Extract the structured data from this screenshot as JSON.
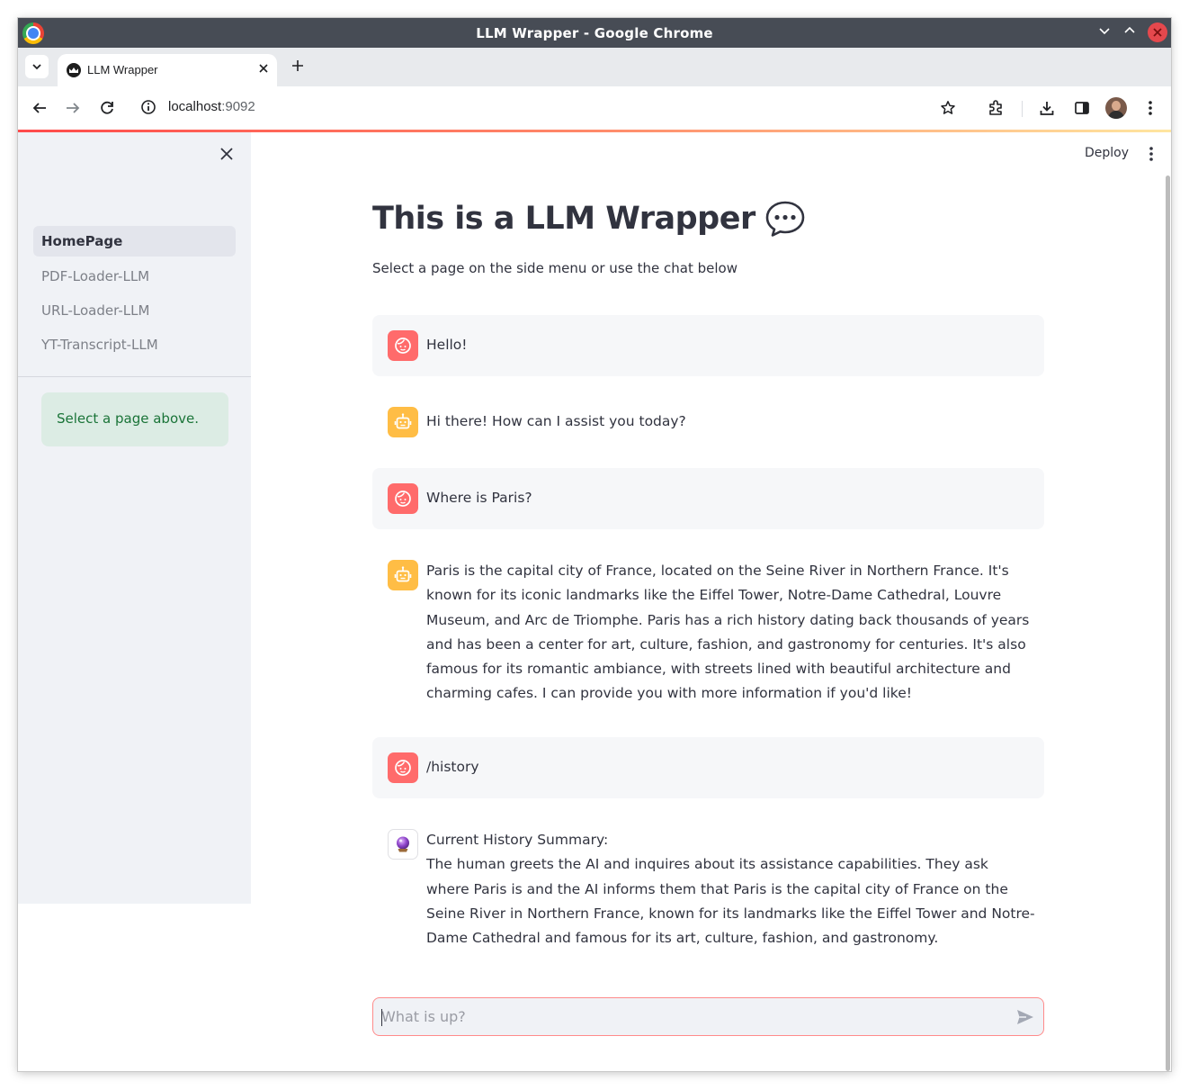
{
  "window": {
    "title": "LLM Wrapper - Google Chrome"
  },
  "tabs": [
    {
      "title": "LLM Wrapper",
      "active": true
    }
  ],
  "toolbar": {
    "url_host": "localhost",
    "url_port": ":9092"
  },
  "app": {
    "deploy_label": "Deploy",
    "title": "This is a LLM Wrapper",
    "title_emoji_icon": "speech-bubble-icon",
    "subtitle": "Select a page on the side menu or use the chat below"
  },
  "sidebar": {
    "items": [
      {
        "label": "HomePage",
        "active": true
      },
      {
        "label": "PDF-Loader-LLM",
        "active": false
      },
      {
        "label": "URL-Loader-LLM",
        "active": false
      },
      {
        "label": "YT-Transcript-LLM",
        "active": false
      }
    ],
    "info": "Select a page above."
  },
  "chat": {
    "messages": [
      {
        "role": "user",
        "avatar": "user-face-icon",
        "text": "Hello!"
      },
      {
        "role": "assistant",
        "avatar": "robot-icon",
        "text": "Hi there! How can I assist you today?"
      },
      {
        "role": "user",
        "avatar": "user-face-icon",
        "text": "Where is Paris?"
      },
      {
        "role": "assistant",
        "avatar": "robot-icon",
        "text": "Paris is the capital city of France, located on the Seine River in Northern France. It's known for its iconic landmarks like the Eiffel Tower, Notre-Dame Cathedral, Louvre Museum, and Arc de Triomphe. Paris has a rich history dating back thousands of years and has been a center for art, culture, fashion, and gastronomy for centuries. It's also famous for its romantic ambiance, with streets lined with beautiful architecture and charming cafes. I can provide you with more information if you'd like!"
      },
      {
        "role": "user",
        "avatar": "user-face-icon",
        "text": "/history"
      },
      {
        "role": "system",
        "avatar": "crystal-ball-icon",
        "heading": "Current History Summary:",
        "text": "The human greets the AI and inquires about its assistance capabilities. They ask where Paris is and the AI informs them that Paris is the capital city of France on the Seine River in Northern France, known for its landmarks like the Eiffel Tower and Notre-Dame Cathedral and famous for its art, culture, fashion, and gastronomy."
      }
    ],
    "input_placeholder": "What is up?",
    "input_value": ""
  },
  "colors": {
    "user_avatar": "#ff6b6b",
    "bot_avatar": "#ffbd45",
    "accent": "#ff4b4b",
    "sidebar_bg": "#f0f2f6",
    "info_bg": "#dcece4",
    "info_text": "#1a7438"
  }
}
